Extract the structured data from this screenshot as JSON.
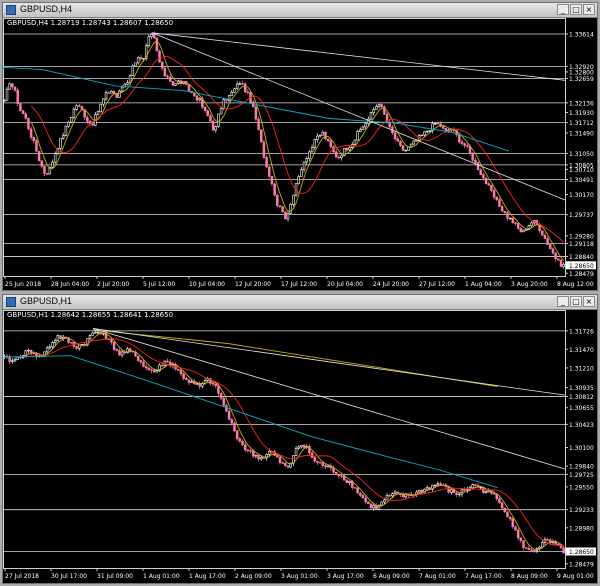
{
  "window1": {
    "title": "GBPUSD,H4",
    "info": "GBPUSD,H4  1.28719 1.28743 1.28607 1.28650",
    "buttons": [
      "_",
      "□",
      "×"
    ]
  },
  "window2": {
    "title": "GBPUSD,H1",
    "info": "GBPUSD,H1  1.28642 1.28655 1.28641 1.28650",
    "buttons": [
      "_",
      "□",
      "×"
    ]
  },
  "colors": {
    "background": "#000000",
    "grid": "#ffffff",
    "bull": "#ffffff",
    "bear": "#ff7bb0",
    "ma_fast": "#c8b400",
    "ma_mid": "#ff2020",
    "ma_slow": "#00b0c8",
    "trendline": "#e8e8e8"
  },
  "chart_data": [
    {
      "type": "candlestick",
      "symbol": "GBPUSD",
      "timeframe": "H4",
      "ylim": [
        1.2842,
        1.337
      ],
      "y_ticks": [
        "1.33614",
        "1.32920",
        "1.32800",
        "1.32659",
        "1.32136",
        "1.31930",
        "1.31712",
        "1.31490",
        "1.31050",
        "1.30805",
        "1.30710",
        "1.30491",
        "1.30170",
        "1.29737",
        "1.29280",
        "1.29118",
        "1.28840",
        "1.28650",
        "1.28479"
      ],
      "y_tick_values": [
        1.33614,
        1.3292,
        1.328,
        1.32659,
        1.32136,
        1.3193,
        1.31712,
        1.3149,
        1.3105,
        1.30805,
        1.3071,
        1.30491,
        1.3017,
        1.29737,
        1.2928,
        1.29118,
        1.2884,
        1.2865,
        1.28479
      ],
      "x_ticks": [
        "25 Jun 2018",
        "28 Jun 04:00",
        "2 Jul 20:00",
        "5 Jul 12:00",
        "10 Jul 04:00",
        "12 Jul 20:00",
        "17 Jul 12:00",
        "20 Jul 04:00",
        "24 Jul 20:00",
        "27 Jul 12:00",
        "1 Aug 04:00",
        "3 Aug 20:00",
        "8 Aug 12:00"
      ],
      "hlines": [
        1.33614,
        1.3292,
        1.32659,
        1.32136,
        1.31712,
        1.3105,
        1.30805,
        1.30491,
        1.29737,
        1.29118,
        1.2884
      ],
      "price_path": [
        1.3215,
        1.326,
        1.324,
        1.32,
        1.3185,
        1.315,
        1.312,
        1.3085,
        1.306,
        1.3075,
        1.311,
        1.3135,
        1.316,
        1.3185,
        1.321,
        1.32,
        1.318,
        1.3165,
        1.319,
        1.3215,
        1.3235,
        1.324,
        1.3225,
        1.325,
        1.326,
        1.329,
        1.3315,
        1.33,
        1.335,
        1.3361,
        1.331,
        1.3275,
        1.327,
        1.325,
        1.326,
        1.3255,
        1.324,
        1.323,
        1.322,
        1.3195,
        1.318,
        1.315,
        1.32,
        1.322,
        1.323,
        1.3245,
        1.326,
        1.324,
        1.322,
        1.318,
        1.313,
        1.308,
        1.305,
        1.3,
        1.299,
        1.296,
        1.301,
        1.304,
        1.308,
        1.31,
        1.312,
        1.314,
        1.315,
        1.313,
        1.311,
        1.3095,
        1.311,
        1.312,
        1.313,
        1.315,
        1.3165,
        1.318,
        1.32,
        1.3215,
        1.319,
        1.316,
        1.314,
        1.312,
        1.311,
        1.312,
        1.313,
        1.314,
        1.315,
        1.316,
        1.317,
        1.3165,
        1.315,
        1.316,
        1.3145,
        1.313,
        1.312,
        1.31,
        1.308,
        1.306,
        1.304,
        1.302,
        1.3,
        1.2985,
        1.297,
        1.296,
        1.2945,
        1.2935,
        1.295,
        1.296,
        1.295,
        1.293,
        1.291,
        1.289,
        1.287,
        1.2865
      ],
      "trendlines": [
        [
          0.265,
          1.3364,
          1.0,
          1.3262
        ],
        [
          0.265,
          1.3364,
          1.0,
          1.3005
        ]
      ],
      "ma_slow": [
        [
          0,
          1.329
        ],
        [
          0.07,
          1.3285
        ],
        [
          0.2,
          1.325
        ],
        [
          0.32,
          1.324
        ],
        [
          0.45,
          1.321
        ],
        [
          0.58,
          1.318
        ],
        [
          0.7,
          1.317
        ],
        [
          0.8,
          1.315
        ],
        [
          0.9,
          1.311
        ]
      ],
      "ma_mid_start": 0.05,
      "ma_fast_start": 0.05
    },
    {
      "type": "candlestick",
      "symbol": "GBPUSD",
      "timeframe": "H1",
      "ylim": [
        1.2842,
        1.3185
      ],
      "y_ticks": [
        "1.31726",
        "1.31470",
        "1.31210",
        "1.30935",
        "1.30812",
        "1.30655",
        "1.30423",
        "1.30100",
        "1.29840",
        "1.29725",
        "1.29550",
        "1.29233",
        "1.28980",
        "1.28650",
        "1.28479"
      ],
      "y_tick_values": [
        1.31726,
        1.3147,
        1.3121,
        1.30935,
        1.30812,
        1.30655,
        1.30423,
        1.301,
        1.2984,
        1.29725,
        1.2955,
        1.29233,
        1.2898,
        1.2865,
        1.28479
      ],
      "x_ticks": [
        "27 Jul 2018",
        "30 Jul 17:00",
        "31 Jul 09:00",
        "1 Aug 01:00",
        "1 Aug 17:00",
        "2 Aug 09:00",
        "3 Aug 01:00",
        "3 Aug 17:00",
        "6 Aug 09:00",
        "7 Aug 01:00",
        "7 Aug 17:00",
        "8 Aug 09:00",
        "9 Aug 01:00"
      ],
      "hlines": [
        1.31726,
        1.30812,
        1.30423,
        1.29725,
        1.29233,
        1.2865
      ],
      "price_path": [
        1.3135,
        1.313,
        1.314,
        1.3145,
        1.3135,
        1.315,
        1.3165,
        1.316,
        1.315,
        1.3155,
        1.317,
        1.3172,
        1.3155,
        1.314,
        1.3145,
        1.3135,
        1.312,
        1.3115,
        1.313,
        1.3125,
        1.311,
        1.31,
        1.3095,
        1.3105,
        1.309,
        1.306,
        1.303,
        1.301,
        1.3,
        1.2995,
        1.3005,
        1.299,
        1.298,
        1.3015,
        1.301,
        1.299,
        1.2985,
        1.2978,
        1.297,
        1.296,
        1.2945,
        1.293,
        1.2925,
        1.294,
        1.2945,
        1.2942,
        1.2945,
        1.295,
        1.2955,
        1.296,
        1.295,
        1.2945,
        1.2952,
        1.2958,
        1.295,
        1.2945,
        1.293,
        1.291,
        1.288,
        1.2865,
        1.287,
        1.288,
        1.2875,
        1.2865
      ],
      "trendlines": [
        [
          0.16,
          1.3176,
          1.0,
          1.3083
        ],
        [
          0.16,
          1.3176,
          1.0,
          1.298
        ]
      ],
      "ma_gold": [
        [
          0.16,
          1.3174
        ],
        [
          0.4,
          1.3155
        ],
        [
          0.6,
          1.313
        ],
        [
          0.8,
          1.3105
        ],
        [
          0.88,
          1.3095
        ]
      ],
      "ma_slow": [
        [
          0,
          1.3136
        ],
        [
          0.12,
          1.3138
        ],
        [
          0.25,
          1.3105
        ],
        [
          0.4,
          1.3065
        ],
        [
          0.55,
          1.3025
        ],
        [
          0.68,
          1.2998
        ],
        [
          0.78,
          1.2978
        ],
        [
          0.88,
          1.2954
        ]
      ],
      "ma_mid_start": 0.04,
      "ma_fast_start": 0.04
    }
  ]
}
